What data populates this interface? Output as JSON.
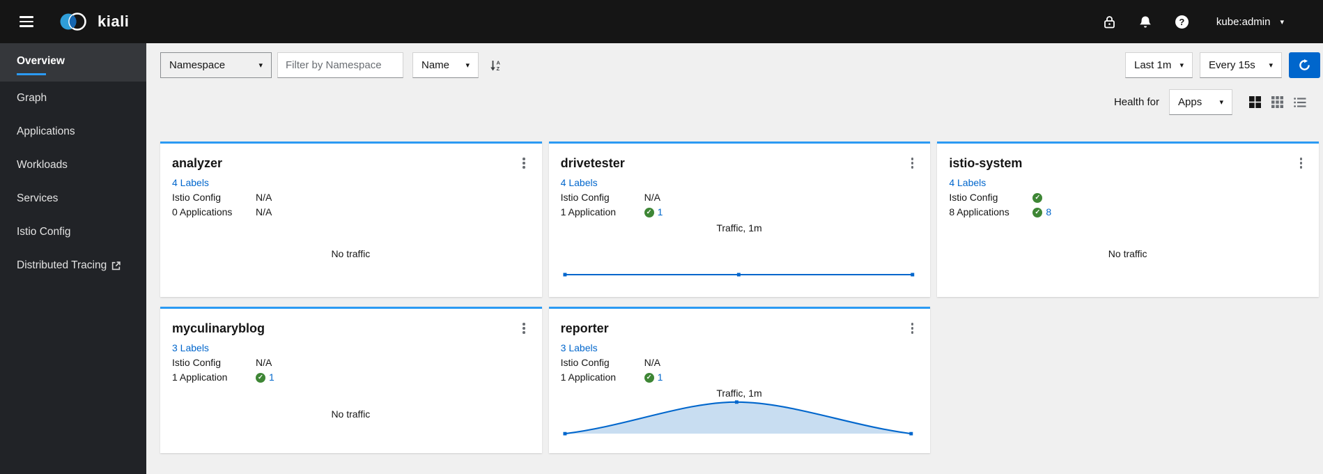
{
  "masthead": {
    "brand": "kiali",
    "user": "kube:admin"
  },
  "sidebar": {
    "items": [
      {
        "label": "Overview",
        "active": true
      },
      {
        "label": "Graph"
      },
      {
        "label": "Applications"
      },
      {
        "label": "Workloads"
      },
      {
        "label": "Services"
      },
      {
        "label": "Istio Config"
      },
      {
        "label": "Distributed Tracing",
        "external": true
      }
    ]
  },
  "toolbar": {
    "filter_type": "Namespace",
    "filter_placeholder": "Filter by Namespace",
    "sort_field": "Name",
    "duration": "Last 1m",
    "refresh_interval": "Every 15s",
    "health_for_label": "Health for",
    "health_for_value": "Apps"
  },
  "cards": [
    {
      "title": "analyzer",
      "labels": "4 Labels",
      "istio_label": "Istio Config",
      "istio_na": "N/A",
      "istio_check": false,
      "apps_label": "0 Applications",
      "apps_na": "N/A",
      "apps_check": false,
      "apps_count": "",
      "traffic_type": "none",
      "traffic_label": "No traffic"
    },
    {
      "title": "drivetester",
      "labels": "4 Labels",
      "istio_label": "Istio Config",
      "istio_na": "N/A",
      "istio_check": false,
      "apps_label": "1 Application",
      "apps_na": "",
      "apps_check": true,
      "apps_count": "1",
      "traffic_type": "flat",
      "traffic_label": "Traffic, 1m",
      "traffic_chart": {
        "type": "line",
        "shape": "constant-near-zero",
        "points_norm": [
          [
            0,
            0
          ],
          [
            0.5,
            0
          ],
          [
            1,
            0
          ]
        ]
      }
    },
    {
      "title": "istio-system",
      "labels": "4 Labels",
      "istio_label": "Istio Config",
      "istio_na": "",
      "istio_check": true,
      "apps_label": "8 Applications",
      "apps_na": "",
      "apps_check": true,
      "apps_count": "8",
      "traffic_type": "none",
      "traffic_label": "No traffic"
    },
    {
      "title": "myculinaryblog",
      "labels": "3 Labels",
      "istio_label": "Istio Config",
      "istio_na": "N/A",
      "istio_check": false,
      "apps_label": "1 Application",
      "apps_na": "",
      "apps_check": true,
      "apps_count": "1",
      "traffic_type": "none",
      "traffic_label": "No traffic"
    },
    {
      "title": "reporter",
      "labels": "3 Labels",
      "istio_label": "Istio Config",
      "istio_na": "N/A",
      "istio_check": false,
      "apps_label": "1 Application",
      "apps_na": "",
      "apps_check": true,
      "apps_count": "1",
      "traffic_type": "area",
      "traffic_label": "Traffic, 1m",
      "traffic_chart": {
        "type": "area",
        "shape": "bell",
        "points_norm": [
          [
            0,
            0
          ],
          [
            0.5,
            1
          ],
          [
            1,
            0
          ]
        ]
      }
    }
  ],
  "colors": {
    "accent_blue": "#0066cc",
    "card_top_border": "#2b9af3",
    "success_green": "#3e8635",
    "masthead_bg": "#151515",
    "sidebar_bg": "#212327",
    "content_bg": "#f0f0f0",
    "chart_fill": "#c8ddf1"
  }
}
